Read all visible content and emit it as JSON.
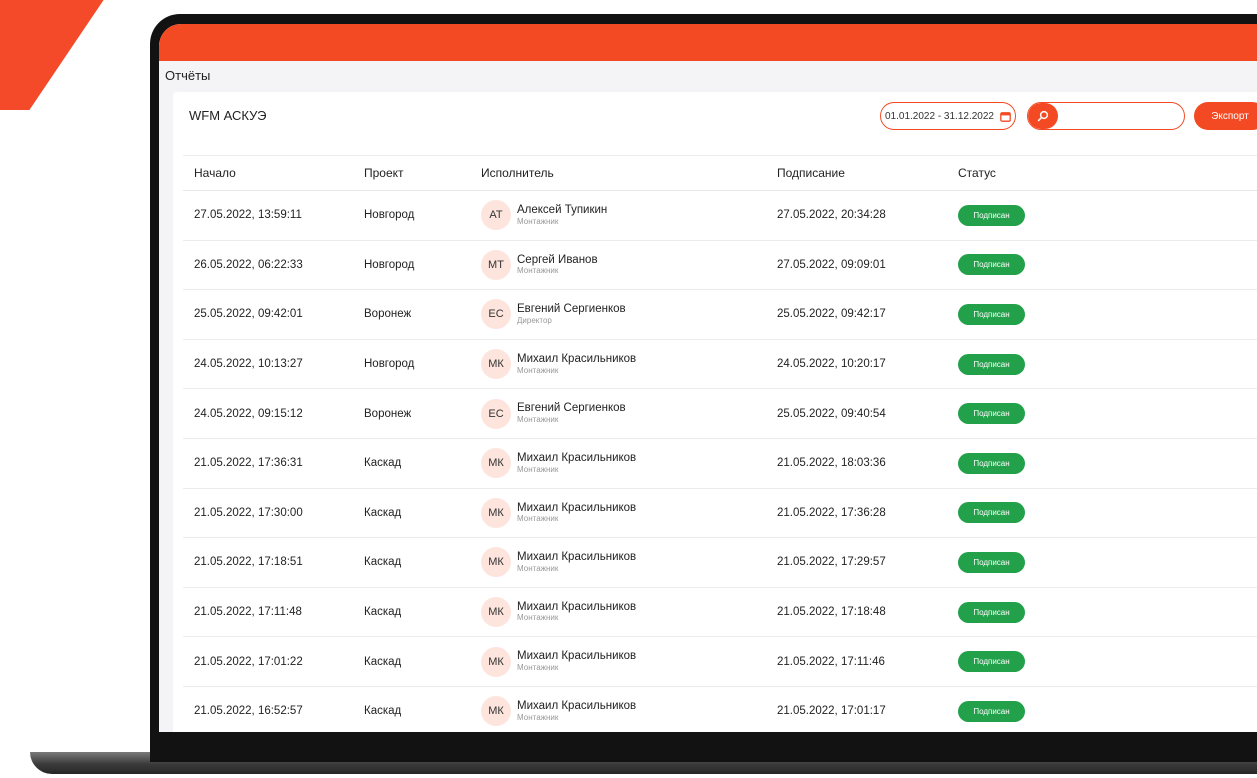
{
  "colors": {
    "accent": "#f44a24",
    "status_signed": "#22a04a",
    "avatar_bg": "#fde5de"
  },
  "breadcrumb": "Отчёты",
  "page_title": "WFM АСКУЭ",
  "toolbar": {
    "date_range": "01.01.2022 - 31.12.2022",
    "calendar_icon": "calendar-icon",
    "search_icon": "search-icon",
    "search_value": "",
    "export_label": "Экспорт"
  },
  "table": {
    "columns": [
      "Начало",
      "Проект",
      "Исполнитель",
      "Подписание",
      "Статус"
    ],
    "rows": [
      {
        "start": "27.05.2022, 13:59:11",
        "project": "Новгород",
        "initials": "АТ",
        "name": "Алексей Тупикин",
        "role": "Монтажник",
        "signed": "27.05.2022, 20:34:28",
        "status": "Подписан"
      },
      {
        "start": "26.05.2022, 06:22:33",
        "project": "Новгород",
        "initials": "МТ",
        "name": "Сергей Иванов",
        "role": "Монтажник",
        "signed": "27.05.2022, 09:09:01",
        "status": "Подписан"
      },
      {
        "start": "25.05.2022, 09:42:01",
        "project": "Воронеж",
        "initials": "ЕС",
        "name": "Евгений Сергиенков",
        "role": "Директор",
        "signed": "25.05.2022, 09:42:17",
        "status": "Подписан"
      },
      {
        "start": "24.05.2022, 10:13:27",
        "project": "Новгород",
        "initials": "МК",
        "name": "Михаил Красильников",
        "role": "Монтажник",
        "signed": "24.05.2022, 10:20:17",
        "status": "Подписан"
      },
      {
        "start": "24.05.2022, 09:15:12",
        "project": "Воронеж",
        "initials": "ЕС",
        "name": "Евгений Сергиенков",
        "role": "Монтажник",
        "signed": "25.05.2022, 09:40:54",
        "status": "Подписан"
      },
      {
        "start": "21.05.2022, 17:36:31",
        "project": "Каскад",
        "initials": "МК",
        "name": "Михаил Красильников",
        "role": "Монтажник",
        "signed": "21.05.2022, 18:03:36",
        "status": "Подписан"
      },
      {
        "start": "21.05.2022, 17:30:00",
        "project": "Каскад",
        "initials": "МК",
        "name": "Михаил Красильников",
        "role": "Монтажник",
        "signed": "21.05.2022, 17:36:28",
        "status": "Подписан"
      },
      {
        "start": "21.05.2022, 17:18:51",
        "project": "Каскад",
        "initials": "МК",
        "name": "Михаил Красильников",
        "role": "Монтажник",
        "signed": "21.05.2022, 17:29:57",
        "status": "Подписан"
      },
      {
        "start": "21.05.2022, 17:11:48",
        "project": "Каскад",
        "initials": "МК",
        "name": "Михаил Красильников",
        "role": "Монтажник",
        "signed": "21.05.2022, 17:18:48",
        "status": "Подписан"
      },
      {
        "start": "21.05.2022, 17:01:22",
        "project": "Каскад",
        "initials": "МК",
        "name": "Михаил Красильников",
        "role": "Монтажник",
        "signed": "21.05.2022, 17:11:46",
        "status": "Подписан"
      },
      {
        "start": "21.05.2022, 16:52:57",
        "project": "Каскад",
        "initials": "МК",
        "name": "Михаил Красильников",
        "role": "Монтажник",
        "signed": "21.05.2022, 17:01:17",
        "status": "Подписан"
      }
    ]
  }
}
